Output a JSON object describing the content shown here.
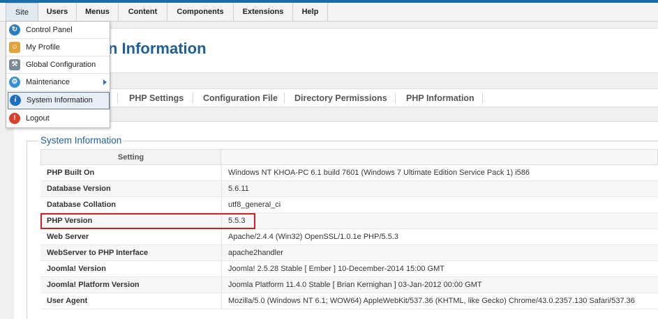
{
  "menubar": {
    "items": [
      {
        "label": "Site"
      },
      {
        "label": "Users"
      },
      {
        "label": "Menus"
      },
      {
        "label": "Content"
      },
      {
        "label": "Components"
      },
      {
        "label": "Extensions"
      },
      {
        "label": "Help"
      }
    ]
  },
  "site_menu": {
    "items": [
      {
        "label": "Control Panel",
        "icon": "control-panel-icon"
      },
      {
        "label": "My Profile",
        "icon": "user-icon"
      },
      {
        "label": "Global Configuration",
        "icon": "tools-icon"
      },
      {
        "label": "Maintenance",
        "icon": "gear-icon",
        "submenu": true
      },
      {
        "label": "System Information",
        "icon": "info-icon",
        "active": true
      },
      {
        "label": "Logout",
        "icon": "logout-icon"
      }
    ]
  },
  "page": {
    "title_visible": "n Information"
  },
  "tabs": [
    {
      "label": "PHP Settings"
    },
    {
      "label": "Configuration File"
    },
    {
      "label": "Directory Permissions"
    },
    {
      "label": "PHP Information"
    }
  ],
  "panel": {
    "legend": "System Information",
    "header_setting": "Setting",
    "rows": [
      {
        "key": "PHP Built On",
        "value": "Windows NT KHOA-PC 6.1 build 7601 (Windows 7 Ultimate Edition Service Pack 1) i586"
      },
      {
        "key": "Database Version",
        "value": "5.6.11"
      },
      {
        "key": "Database Collation",
        "value": "utf8_general_ci"
      },
      {
        "key": "PHP Version",
        "value": "5.5.3"
      },
      {
        "key": "Web Server",
        "value": "Apache/2.4.4 (Win32) OpenSSL/1.0.1e PHP/5.5.3"
      },
      {
        "key": "WebServer to PHP Interface",
        "value": "apache2handler"
      },
      {
        "key": "Joomla! Version",
        "value": "Joomla! 2.5.28 Stable [ Ember ] 10-December-2014 15:00 GMT"
      },
      {
        "key": "Joomla! Platform Version",
        "value": "Joomla Platform 11.4.0 Stable [ Brian Kernighan ] 03-Jan-2012 00:00 GMT"
      },
      {
        "key": "User Agent",
        "value": "Mozilla/5.0 (Windows NT 6.1; WOW64) AppleWebKit/537.36 (KHTML, like Gecko) Chrome/43.0.2357.130 Safari/537.36"
      }
    ]
  },
  "colors": {
    "accent": "#1e5f99",
    "highlight": "#d21f1f"
  }
}
